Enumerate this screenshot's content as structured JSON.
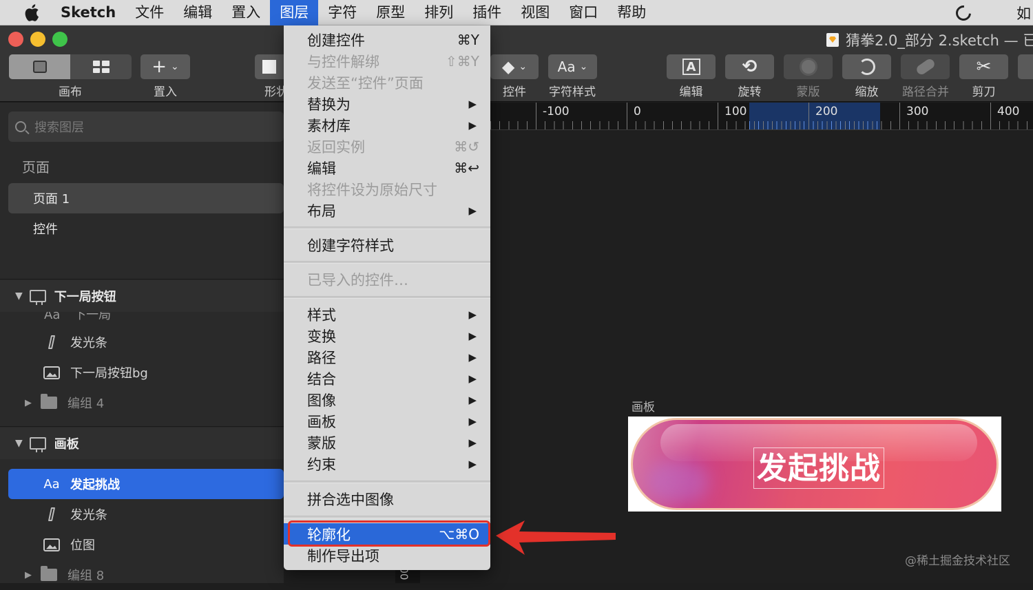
{
  "menubar": {
    "app": "Sketch",
    "items": [
      "文件",
      "编辑",
      "置入",
      "图层",
      "字符",
      "原型",
      "排列",
      "插件",
      "视图",
      "窗口",
      "帮助"
    ],
    "active_item": "图层",
    "right_extra": "如"
  },
  "window": {
    "title": "猜拳2.0_部分 2.sketch — 已"
  },
  "toolbar": {
    "canvas_label": "画布",
    "insert_label": "置入",
    "shape_label": "形状",
    "symbol_label": "控件",
    "text_style_label": "字符样式",
    "text_style_btn": "Aa",
    "edit_label": "编辑",
    "rotate_label": "旋转",
    "mask_label": "蒙版",
    "scale_label": "缩放",
    "path_merge_label": "路径合并",
    "scissors_label": "剪刀"
  },
  "sidebar": {
    "search_placeholder": "搜索图层",
    "pages_header": "页面",
    "pages": [
      "页面 1",
      "控件"
    ],
    "group1": {
      "name": "下一局按钮",
      "partial_layer": "下一局",
      "layers": [
        {
          "name": "发光条",
          "icon": "bar-icon"
        },
        {
          "name": "下一局按钮bg",
          "icon": "image-icon"
        },
        {
          "name": "编组 4",
          "icon": "folder-icon"
        }
      ]
    },
    "group2": {
      "name": "画板",
      "layers": [
        {
          "name": "发起挑战",
          "icon": "text-icon",
          "icon_text": "Aa"
        },
        {
          "name": "发光条",
          "icon": "bar-icon"
        },
        {
          "name": "位图",
          "icon": "image-icon"
        },
        {
          "name": "编组 8",
          "icon": "folder-icon"
        }
      ]
    }
  },
  "ruler": {
    "labels": [
      "-100",
      "0",
      "100",
      "200",
      "300",
      "400"
    ],
    "bottom_vertical": "00"
  },
  "canvas": {
    "artboard_label": "画板",
    "button_text": "发起挑战",
    "watermark": "@稀土掘金技术社区"
  },
  "layer_menu": {
    "items": [
      {
        "label": "创建控件",
        "shortcut": "⌘Y"
      },
      {
        "label": "与控件解绑",
        "shortcut": "⇧⌘Y",
        "disabled": true
      },
      {
        "label": "发送至“控件”页面",
        "disabled": true
      },
      {
        "label": "替换为",
        "submenu": true
      },
      {
        "label": "素材库",
        "submenu": true
      },
      {
        "label": "返回实例",
        "shortcut": "⌘↺",
        "disabled": true
      },
      {
        "label": "编辑",
        "shortcut": "⌘↩"
      },
      {
        "label": "将控件设为原始尺寸",
        "disabled": true
      },
      {
        "label": "布局",
        "submenu": true
      },
      {
        "label": "创建字符样式"
      },
      {
        "label": "已导入的控件…",
        "disabled": true
      },
      {
        "label": "样式",
        "submenu": true
      },
      {
        "label": "变换",
        "submenu": true
      },
      {
        "label": "路径",
        "submenu": true
      },
      {
        "label": "结合",
        "submenu": true
      },
      {
        "label": "图像",
        "submenu": true
      },
      {
        "label": "画板",
        "submenu": true
      },
      {
        "label": "蒙版",
        "submenu": true
      },
      {
        "label": "约束",
        "submenu": true
      },
      {
        "label": "拼合选中图像"
      },
      {
        "label": "轮廓化",
        "shortcut": "⌥⌘O",
        "highlighted": true
      },
      {
        "label": "制作导出项"
      }
    ],
    "submenu_glyph": "▶"
  },
  "colors": {
    "accent": "#2a68d8",
    "annotation_red": "#e3312a",
    "selection_blue": "#2d6ae0"
  }
}
